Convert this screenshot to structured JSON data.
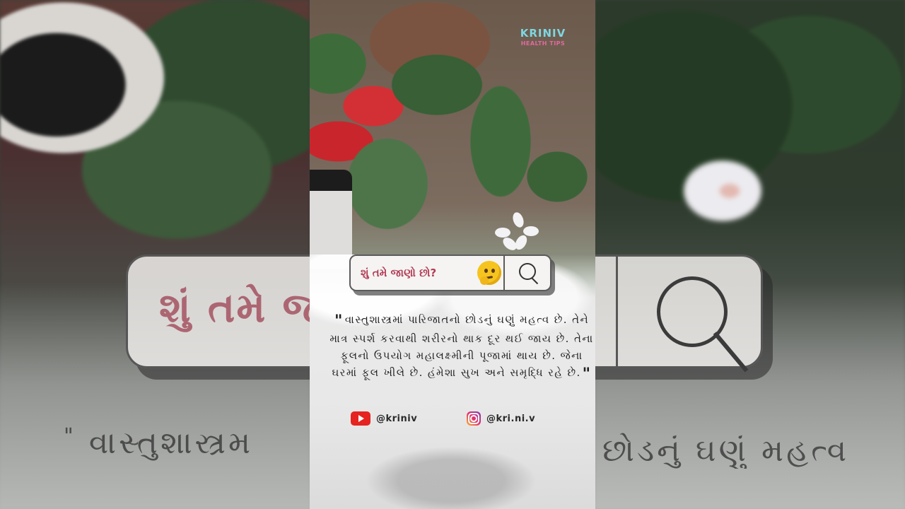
{
  "brand": {
    "name": "KRINIV",
    "tagline": "HEALTH TIPS"
  },
  "search": {
    "text": "શું તમે જાણો છો?",
    "emoji": "thinking-face",
    "icon": "search-icon"
  },
  "quote": {
    "open_mark": "\"",
    "text": "વાસ્તુશાસ્ત્રમાં પારિજાતનો છોડનું ઘણું મહત્વ છે. તેને માત્ર સ્પર્શ કરવાથી શરીરનો થાક દૂર થઈ જાય છે. તેના ફૂલનો ઉપયોગ મહાલક્ષ્મીની પૂજામાં થાય છે. જેના ઘરમાં ફૂલ ખીલે છે. હંમેશા સુખ અને સમૃદ્ધિ રહે છે.",
    "close_mark": "\""
  },
  "social": {
    "youtube": {
      "icon": "youtube-icon",
      "handle": "@kriniv"
    },
    "instagram": {
      "icon": "instagram-icon",
      "handle": "@kri.ni.v"
    }
  },
  "echo": {
    "search_text": "શું તમે જ",
    "quote_left": "વાસ્તુશાસ્ત્રમ",
    "quote_right": "છોડનું ઘણું મહત્વ"
  },
  "colors": {
    "search_text": "#b23b55",
    "youtube": "#e52320",
    "brand_name": "#7ed6e0",
    "brand_sub": "#e06a9c"
  }
}
